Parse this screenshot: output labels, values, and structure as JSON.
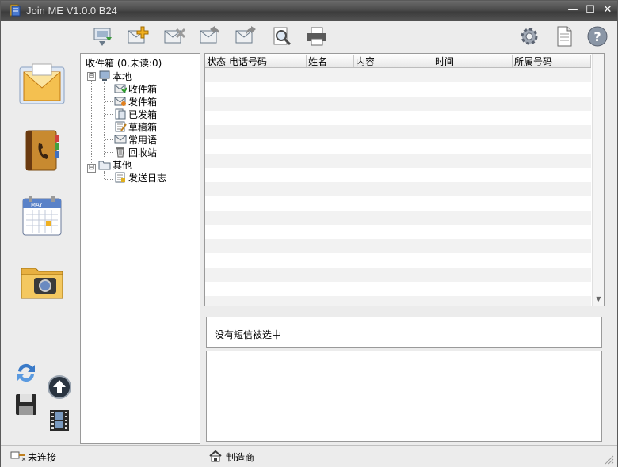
{
  "window": {
    "title": "Join ME V1.0.0 B24",
    "minimize": "—",
    "maximize": "☐",
    "close": "✕"
  },
  "toolbar": {
    "left_icons": [
      "receive-icon",
      "new-message-icon",
      "delete-message-icon",
      "reply-icon",
      "forward-icon",
      "search-icon",
      "print-icon"
    ],
    "right_icons": [
      "settings-icon",
      "document-icon",
      "help-icon"
    ]
  },
  "nav": {
    "icons": [
      "sms-envelope-icon",
      "contacts-book-icon",
      "calendar-icon",
      "media-folder-icon"
    ],
    "bottom_icons": [
      "sync-icon",
      "upload-icon",
      "save-icon",
      "video-icon"
    ]
  },
  "tree": {
    "header": "收件箱 (0,未读:0)",
    "local": "本地",
    "local_items": [
      "收件箱",
      "发件箱",
      "已发箱",
      "草稿箱",
      "常用语",
      "回收站"
    ],
    "other": "其他",
    "other_items": [
      "发送日志"
    ],
    "expander": "⊟"
  },
  "list": {
    "columns": [
      "状态",
      "电话号码",
      "姓名",
      "内容",
      "时间",
      "所属号码"
    ],
    "row_count": 17,
    "scroll_down": "▼"
  },
  "preview": {
    "message": "没有短信被选中"
  },
  "status": {
    "connection": "未连接",
    "manufacturer": "制造商"
  },
  "colors": {
    "titlebar": "#4a4a4a",
    "row_alt": "#f2f2f2",
    "border": "#9a9a9a"
  }
}
